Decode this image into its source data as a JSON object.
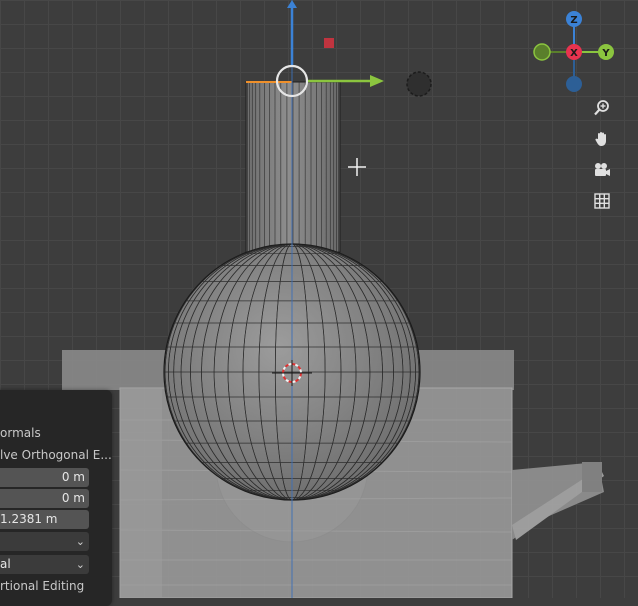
{
  "gizmo": {
    "axis_z": "Z",
    "axis_x": "X",
    "axis_y": "Y",
    "colors": {
      "x": "#e8334f",
      "y": "#8bc53f",
      "z": "#3b82d6",
      "neg_x": "#9a2232",
      "neg_z": "#2d5f96"
    }
  },
  "nav_tools": {
    "zoom_icon": "magnifier-plus",
    "pan_icon": "hand",
    "camera_icon": "camera",
    "ortho_icon": "grid"
  },
  "operator_panel": {
    "normals_label": "ormals",
    "dissolve_label": "lve Orthogonal E...",
    "offset_x": "0 m",
    "offset_y": "0 m",
    "offset_z": "1.2381 m",
    "select_1_value": "",
    "select_2_value": "al",
    "proportional_label": "rtional Editing"
  }
}
